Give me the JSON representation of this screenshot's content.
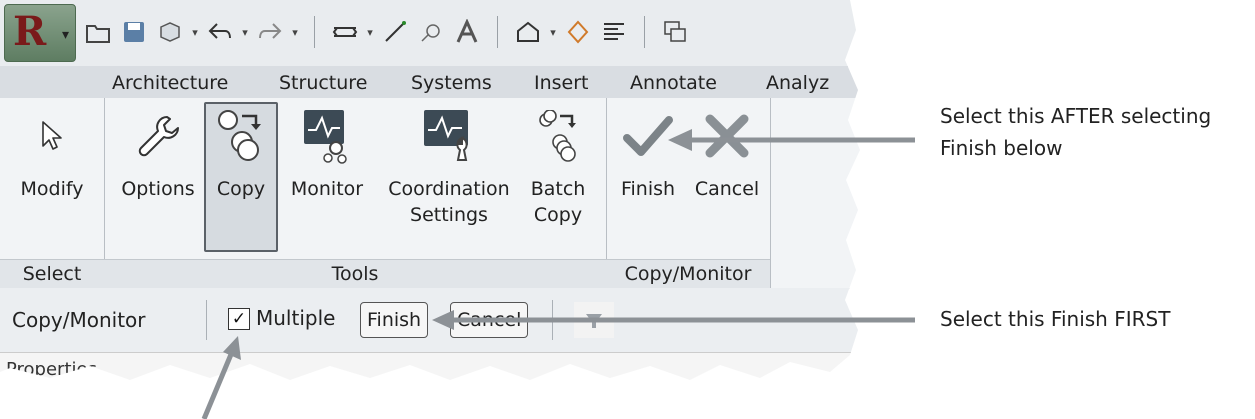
{
  "app": {
    "logo_letter": "R"
  },
  "quick_access": {
    "icons": [
      "open-folder-icon",
      "save-icon",
      "sync-icon",
      "undo-icon",
      "redo-icon",
      "measure-icon",
      "dimension-icon",
      "tag-icon",
      "text-icon",
      "3d-view-icon",
      "section-icon",
      "thin-lines-icon",
      "switch-windows-icon"
    ]
  },
  "tabs": [
    "Architecture",
    "Structure",
    "Systems",
    "Insert",
    "Annotate",
    "Analyz"
  ],
  "ribbon": {
    "select_panel": {
      "title": "Select",
      "modify": "Modify"
    },
    "tools_panel": {
      "title": "Tools",
      "options": "Options",
      "copy": "Copy",
      "monitor": "Monitor",
      "coordination_line1": "Coordination",
      "coordination_line2": "Settings",
      "batch_line1": "Batch",
      "batch_line2": "Copy"
    },
    "copy_monitor_panel": {
      "title": "Copy/Monitor",
      "finish": "Finish",
      "cancel": "Cancel"
    }
  },
  "options_bar": {
    "context": "Copy/Monitor",
    "multiple_checked": true,
    "check_glyph": "✓",
    "multiple": "Multiple",
    "finish": "Finish",
    "cancel": "Cancel"
  },
  "properties": {
    "label": "Properties"
  },
  "annotations": {
    "top_line1": "Select this AFTER selecting",
    "top_line2": "Finish below",
    "bottom": "Select this Finish FIRST"
  },
  "colors": {
    "checkmark": "#7c8388",
    "cancel_x": "#8a9095",
    "arrow": "#8c9196"
  }
}
